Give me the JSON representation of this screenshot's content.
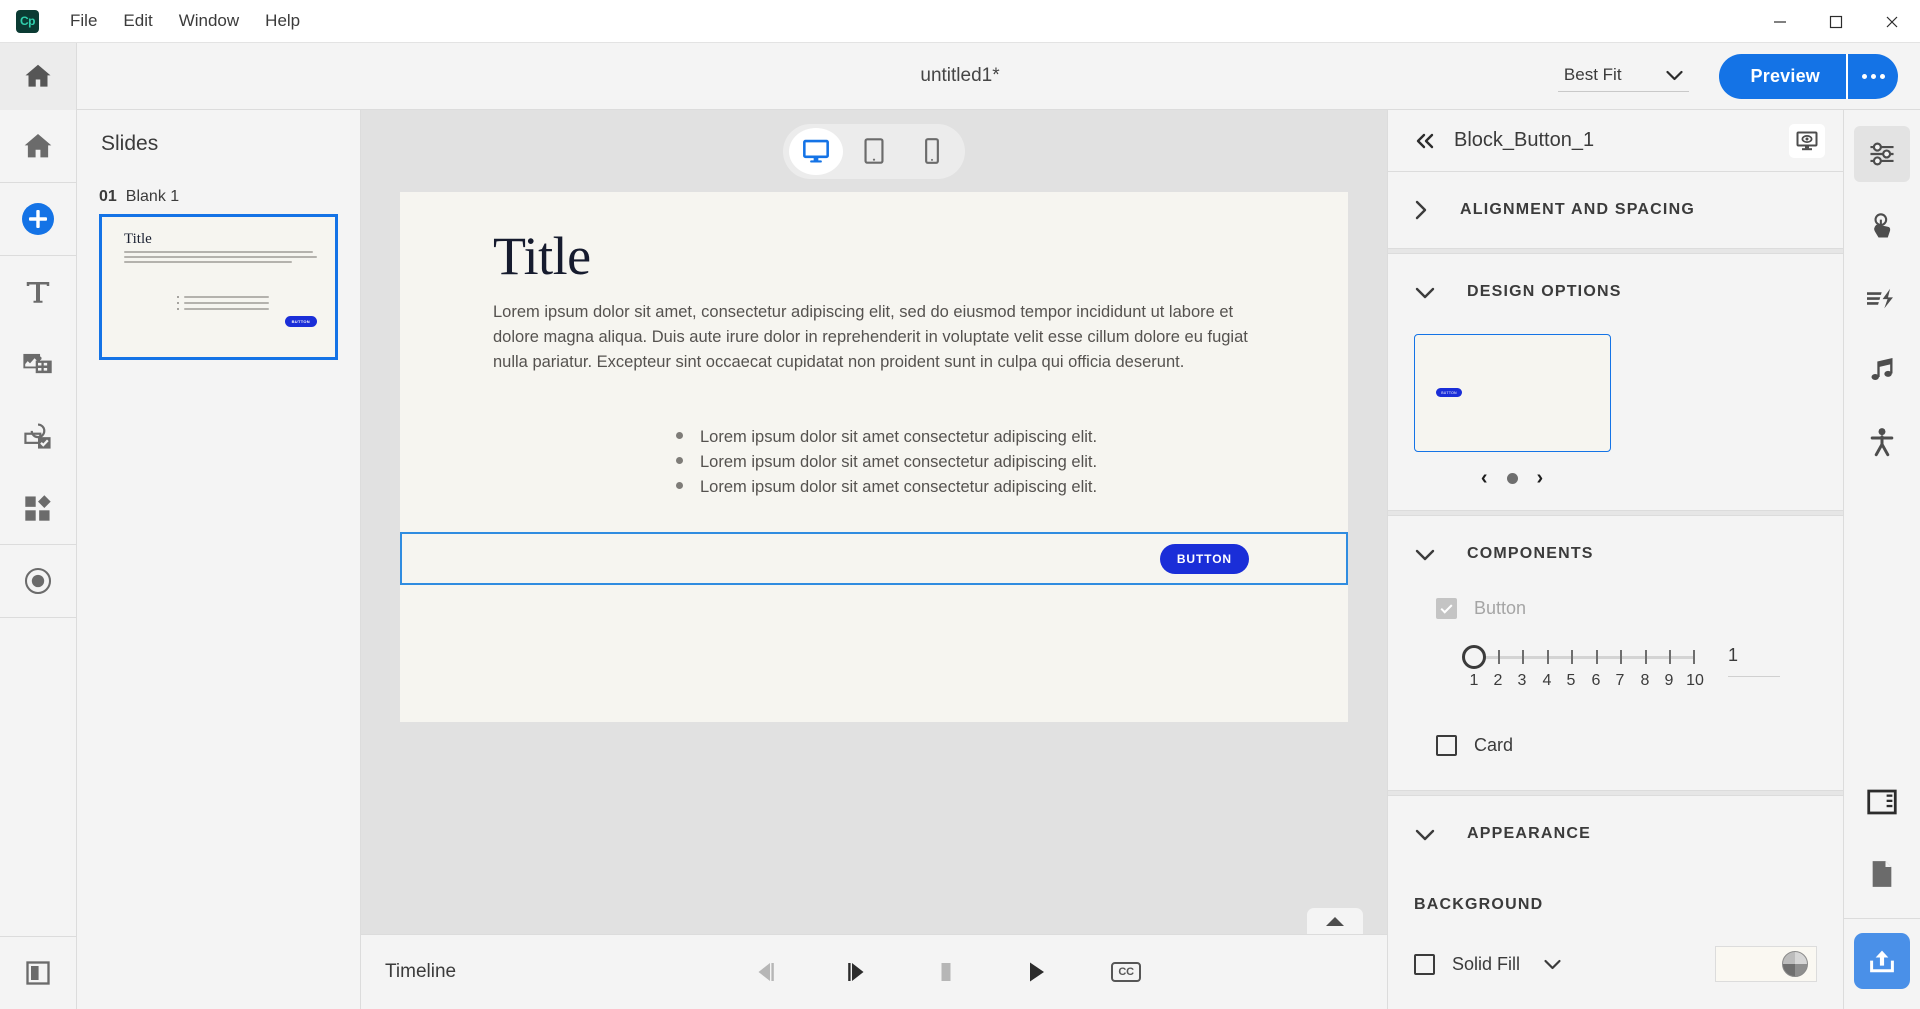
{
  "app": {
    "logo_text": "Cp",
    "menus": [
      "File",
      "Edit",
      "Window",
      "Help"
    ],
    "window_buttons": [
      "minimize-button",
      "maximize-button",
      "close-button"
    ]
  },
  "toolbar": {
    "home_icon": "home-icon",
    "document_title": "untitled1*",
    "zoom_value": "Best Fit",
    "preview_label": "Preview",
    "more_label": "more-options"
  },
  "left_rail": {
    "items": [
      {
        "name": "home-icon",
        "label": "Home"
      },
      {
        "name": "add-icon",
        "label": "Add"
      },
      {
        "name": "text-icon",
        "label": "Text"
      },
      {
        "name": "media-icon",
        "label": "Media"
      },
      {
        "name": "interaction-icon",
        "label": "Interactions"
      },
      {
        "name": "widgets-icon",
        "label": "Widgets"
      },
      {
        "name": "record-icon",
        "label": "Record"
      },
      {
        "name": "library-icon",
        "label": "Library"
      }
    ]
  },
  "slides": {
    "title": "Slides",
    "items": [
      {
        "number": "01",
        "name": "Blank 1",
        "thumb_title": "Title",
        "thumb_button_label": "BUTTON"
      }
    ]
  },
  "canvas": {
    "devices": [
      {
        "name": "desktop-device-button",
        "active": true
      },
      {
        "name": "tablet-device-button",
        "active": false
      },
      {
        "name": "mobile-device-button",
        "active": false
      }
    ],
    "slide": {
      "title": "Title",
      "paragraph": "Lorem ipsum dolor sit amet, consectetur adipiscing elit, sed do eiusmod tempor incididunt ut labore et dolore magna aliqua. Duis aute irure dolor in reprehenderit in voluptate velit esse cillum dolore eu fugiat nulla pariatur. Excepteur sint occaecat cupidatat non proident sunt in culpa qui officia deserunt.",
      "bullets": [
        "Lorem ipsum dolor sit amet consectetur adipiscing elit.",
        "Lorem ipsum dolor sit amet consectetur adipiscing elit.",
        "Lorem ipsum dolor sit amet consectetur adipiscing elit."
      ],
      "button_label": "BUTTON",
      "background_color": "#f6f5f0",
      "selection_color": "#2f8ce0"
    }
  },
  "timeline": {
    "label": "Timeline",
    "controls": [
      {
        "name": "step-backward-button",
        "disabled": true
      },
      {
        "name": "step-forward-button",
        "disabled": false
      },
      {
        "name": "stop-button",
        "disabled": true
      },
      {
        "name": "play-button",
        "disabled": false
      },
      {
        "name": "closed-captions-button",
        "label": "CC",
        "disabled": false
      }
    ],
    "expand_icon": "chevron-up-icon"
  },
  "right_panel": {
    "collapse_icon": "double-chevron-left-icon",
    "title": "Block_Button_1",
    "preview_icon": "preview-on-device-icon",
    "sections": [
      {
        "key": "alignment",
        "label": "ALIGNMENT AND SPACING",
        "expanded": false
      },
      {
        "key": "design",
        "label": "DESIGN OPTIONS",
        "expanded": true
      },
      {
        "key": "components",
        "label": "COMPONENTS",
        "expanded": true
      },
      {
        "key": "appearance",
        "label": "APPEARANCE",
        "expanded": true
      }
    ],
    "design_options": {
      "thumb_button_label": "BUTTON",
      "prev_label": "‹",
      "next_label": "›"
    },
    "components": {
      "button": {
        "label": "Button",
        "checked": true,
        "disabled": true
      },
      "card": {
        "label": "Card",
        "checked": false,
        "disabled": false
      },
      "slider": {
        "value": "1",
        "min": 1,
        "max": 10,
        "ticks": [
          "1",
          "2",
          "3",
          "4",
          "5",
          "6",
          "7",
          "8",
          "9",
          "10"
        ]
      }
    },
    "appearance": {
      "background_label": "BACKGROUND",
      "fill_label": "Solid Fill",
      "fill_checked": false,
      "fill_color": "#faf8f2"
    }
  },
  "far_rail": {
    "items": [
      {
        "name": "properties-icon",
        "active": true
      },
      {
        "name": "interactions-icon",
        "active": false
      },
      {
        "name": "effects-icon",
        "active": false
      },
      {
        "name": "audio-icon",
        "active": false
      },
      {
        "name": "accessibility-icon",
        "active": false
      }
    ],
    "bottom_items": [
      {
        "name": "layout-panel-icon"
      },
      {
        "name": "page-properties-icon"
      },
      {
        "name": "publish-button"
      }
    ]
  },
  "colors": {
    "accent": "#1473e6",
    "button_blue": "#1a2ed8",
    "selection": "#2f8ce0",
    "panel_bg": "#f4f4f4",
    "canvas_bg": "#e1e1e1",
    "slide_bg": "#f6f5f0"
  }
}
